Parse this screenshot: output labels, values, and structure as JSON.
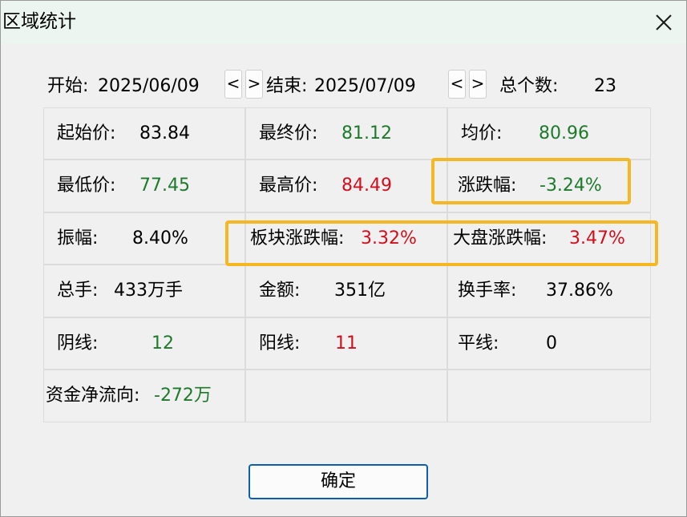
{
  "window": {
    "title": "区域统计",
    "colors": {
      "titlebar": "#ecf5ef",
      "up": "#d10f1c",
      "down": "#1d7a2b",
      "highlight": "#f5b722",
      "button_border": "#0b5fb0"
    }
  },
  "header": {
    "start_label": "开始:",
    "start_date": "2025/06/09",
    "prev_label": "<",
    "next_label": ">",
    "end_label": "结束:",
    "end_date": "2025/07/09",
    "count_label": "总个数:",
    "count_value": "23"
  },
  "stats": {
    "start_price": {
      "label": "起始价:",
      "value": "83.84"
    },
    "end_price": {
      "label": "最终价:",
      "value": "81.12"
    },
    "avg_price": {
      "label": "均价:",
      "value": "80.96"
    },
    "low_price": {
      "label": "最低价:",
      "value": "77.45"
    },
    "high_price": {
      "label": "最高价:",
      "value": "84.49"
    },
    "change_pct": {
      "label": "涨跌幅:",
      "value": "-3.24%"
    },
    "amplitude": {
      "label": "振幅:",
      "value": "8.40%"
    },
    "sector_change": {
      "label": "板块涨跌幅:",
      "value": "3.32%"
    },
    "market_change": {
      "label": "大盘涨跌幅:",
      "value": "3.47%"
    },
    "volume": {
      "label": "总手:",
      "value": "433万手"
    },
    "amount": {
      "label": "金额:",
      "value": "351亿"
    },
    "turnover": {
      "label": "换手率:",
      "value": "37.86%"
    },
    "down_days": {
      "label": "阴线:",
      "value": "12"
    },
    "up_days": {
      "label": "阳线:",
      "value": "11"
    },
    "flat_days": {
      "label": "平线:",
      "value": "0"
    },
    "net_flow": {
      "label": "资金净流向:",
      "value": "-272万"
    }
  },
  "footer": {
    "ok_label": "确定"
  }
}
